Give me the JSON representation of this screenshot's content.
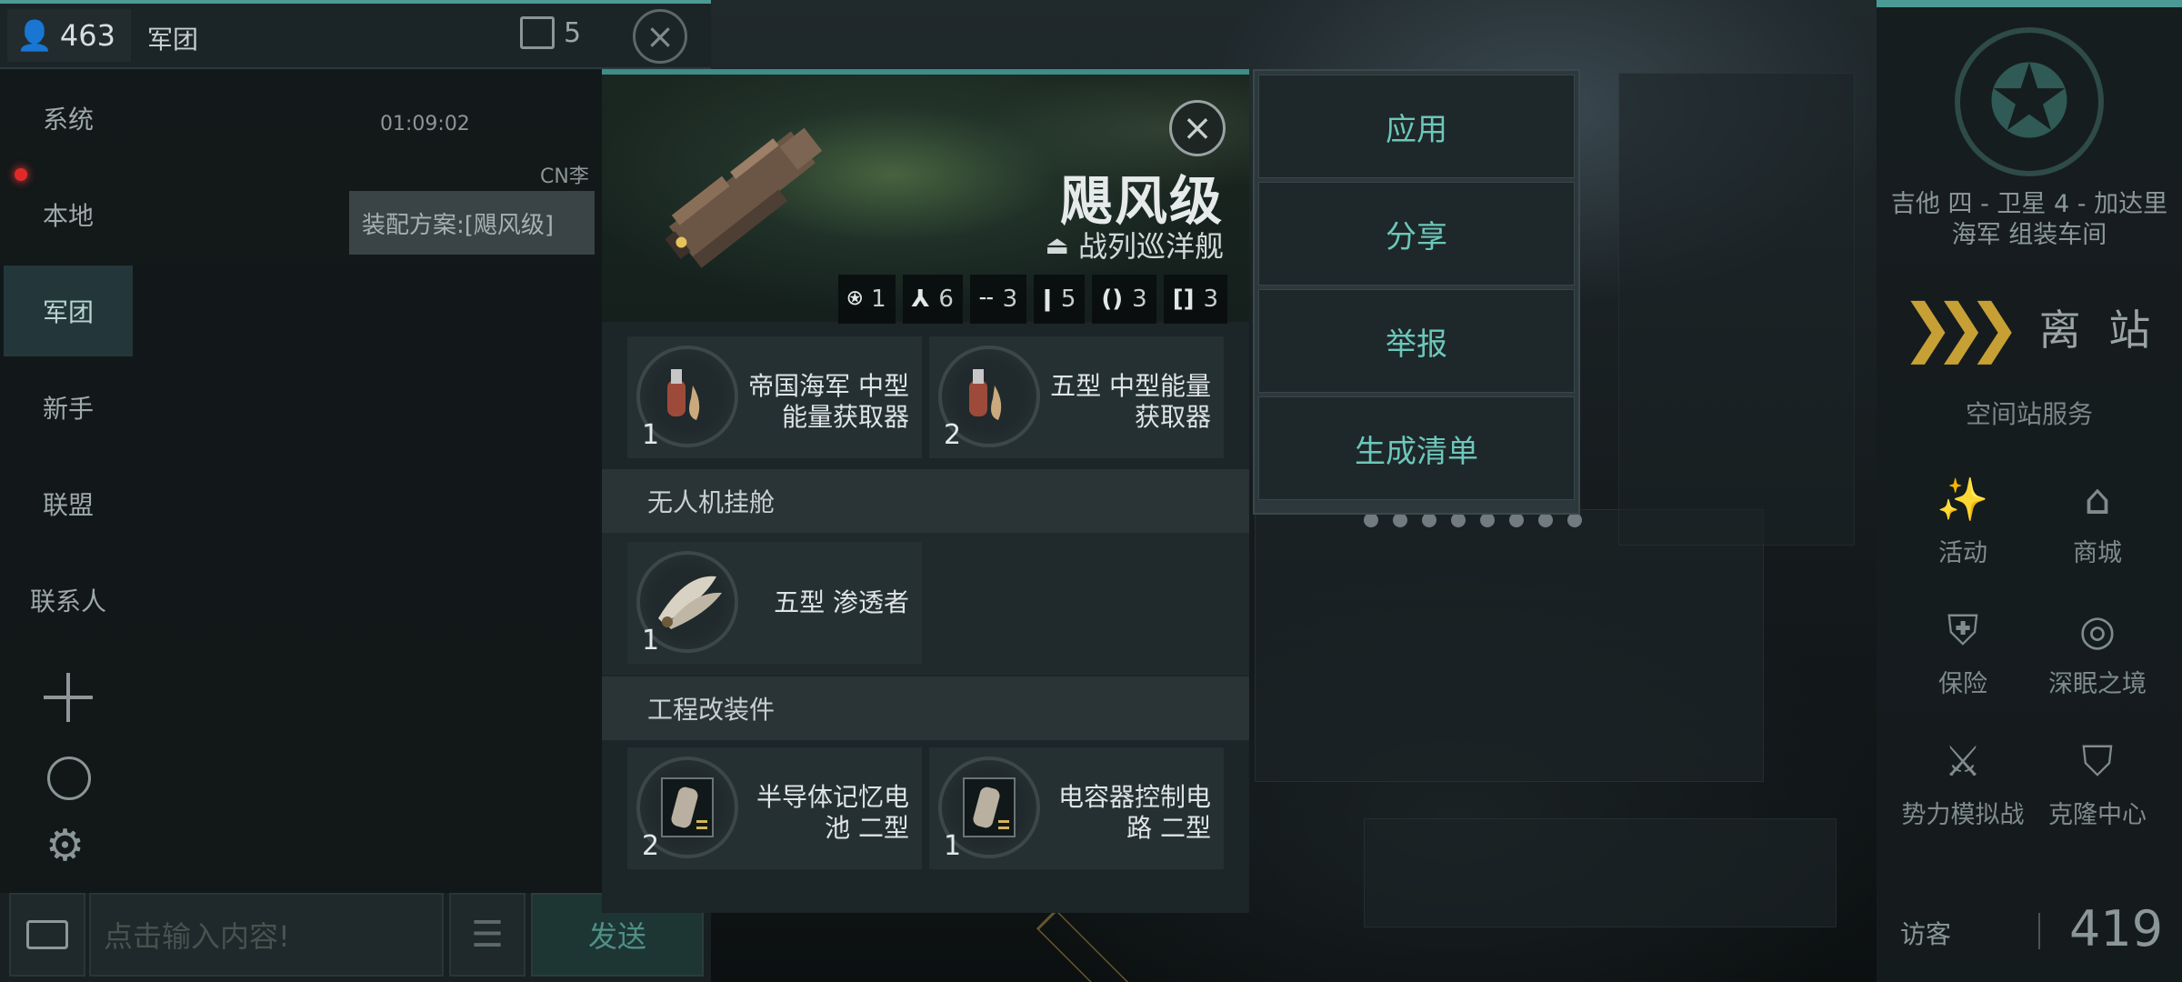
{
  "chat": {
    "online_count": "463",
    "channel_title": "军团",
    "unread_count": "5",
    "channels": [
      "系统",
      "本地",
      "军团",
      "新手",
      "联盟",
      "联系人"
    ],
    "active_channel": "军团",
    "timestamp": "01:09:02",
    "sender": "CN李",
    "message": "装配方案:[飓风级]",
    "input_placeholder": "点击输入内容!",
    "send_label": "发送"
  },
  "fitting": {
    "ship_name": "飓风级",
    "ship_class": "战列巡洋舰",
    "slots": [
      {
        "icon": "high-slot-icon",
        "glyph": "⍟",
        "count": "1"
      },
      {
        "icon": "turret-icon",
        "glyph": "⅄",
        "count": "6"
      },
      {
        "icon": "mid-slot-icon",
        "glyph": "╌",
        "count": "3"
      },
      {
        "icon": "low-slot-icon",
        "glyph": "ǀ",
        "count": "5"
      },
      {
        "icon": "rig-icon",
        "glyph": "()",
        "count": "3"
      },
      {
        "icon": "drone-bay-icon",
        "glyph": "[]",
        "count": "3"
      }
    ],
    "modules_top": [
      {
        "qty": "1",
        "name": "帝国海军 中型 能量获取器",
        "line1": "帝国海军 中型",
        "line2": "能量获取器"
      },
      {
        "qty": "2",
        "name": "五型 中型能量 获取器",
        "line1": "五型 中型能量",
        "line2": "获取器"
      }
    ],
    "drone_section": "无人机挂舱",
    "drones": [
      {
        "qty": "1",
        "name": "五型 渗透者"
      }
    ],
    "rig_section": "工程改装件",
    "rigs": [
      {
        "qty": "2",
        "line1": "半导体记忆电",
        "line2": "池 二型"
      },
      {
        "qty": "1",
        "line1": "电容器控制电",
        "line2": "路 二型"
      }
    ]
  },
  "context_menu": {
    "items": [
      "应用",
      "分享",
      "举报",
      "生成清单"
    ]
  },
  "station": {
    "name_line1": "吉他 四 - 卫星 4 - 加达里",
    "name_line2": "海军 组装车间",
    "undock_label": "离 站",
    "services_title": "空间站服务",
    "services": [
      {
        "label": "活动",
        "icon": "fireworks-icon",
        "glyph": "✨"
      },
      {
        "label": "商城",
        "icon": "store-icon",
        "glyph": "⌂"
      },
      {
        "label": "保险",
        "icon": "shield-icon",
        "glyph": "⛨"
      },
      {
        "label": "深眠之境",
        "icon": "portal-icon",
        "glyph": "◎"
      },
      {
        "label": "势力模拟战",
        "icon": "crossed-flags-icon",
        "glyph": "⚔"
      },
      {
        "label": "克隆中心",
        "icon": "clone-icon",
        "glyph": "⛉"
      }
    ],
    "visitors_label": "访客",
    "visitors_count": "419"
  },
  "colors": {
    "accent_teal": "#4c9a95",
    "menu_text": "#6cc7ba",
    "undock_gold": "#c7a035",
    "alert_red": "#e02a2a"
  }
}
